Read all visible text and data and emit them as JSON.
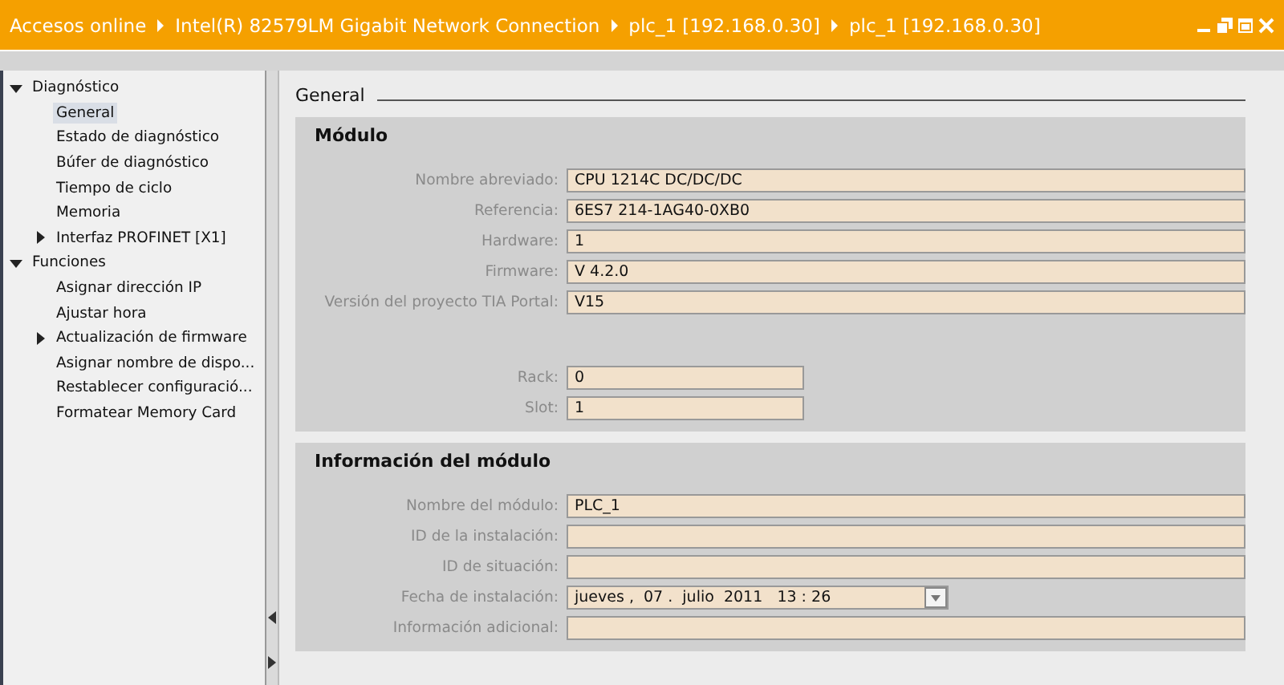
{
  "breadcrumb": [
    "Accesos online",
    "Intel(R) 82579LM Gigabit Network Connection",
    "plc_1 [192.168.0.30]",
    "plc_1 [192.168.0.30]"
  ],
  "tree": [
    {
      "label": "Diagnóstico",
      "expanded": true,
      "selected": false,
      "children": [
        {
          "label": "General",
          "selected": true
        },
        {
          "label": "Estado de diagnóstico",
          "selected": false
        },
        {
          "label": "Búfer de diagnóstico",
          "selected": false
        },
        {
          "label": "Tiempo de ciclo",
          "selected": false
        },
        {
          "label": "Memoria",
          "selected": false
        },
        {
          "label": "Interfaz PROFINET [X1]",
          "expanded": false,
          "selected": false
        }
      ]
    },
    {
      "label": "Funciones",
      "expanded": true,
      "selected": false,
      "children": [
        {
          "label": "Asignar dirección IP",
          "selected": false
        },
        {
          "label": "Ajustar hora",
          "selected": false
        },
        {
          "label": "Actualización de firmware",
          "expanded": false,
          "selected": false
        },
        {
          "label": "Asignar nombre de dispo...",
          "selected": false
        },
        {
          "label": "Restablecer configuració...",
          "selected": false
        },
        {
          "label": "Formatear Memory Card",
          "selected": false
        }
      ]
    }
  ],
  "page_title": "General",
  "sections": [
    {
      "title": "Módulo",
      "fields": [
        {
          "label": "Nombre abreviado:",
          "value": "CPU 1214C DC/DC/DC",
          "kind": "long"
        },
        {
          "label": "Referencia:",
          "value": "6ES7 214-1AG40-0XB0",
          "kind": "long"
        },
        {
          "label": "Hardware:",
          "value": "1",
          "kind": "long"
        },
        {
          "label": "Firmware:",
          "value": "V 4.2.0",
          "kind": "long"
        },
        {
          "label": "Versión del proyecto TIA Portal:",
          "value": "V15",
          "kind": "long"
        },
        {
          "label": "Rack:",
          "value": "0",
          "kind": "short"
        },
        {
          "label": "Slot:",
          "value": "1",
          "kind": "short"
        }
      ]
    },
    {
      "title": "Información del módulo",
      "fields": [
        {
          "label": "Nombre del módulo:",
          "value": "PLC_1",
          "kind": "long"
        },
        {
          "label": "ID de la instalación:",
          "kind": "long"
        },
        {
          "label": "ID de situación:",
          "kind": "long"
        },
        {
          "label": "Fecha de instalación:",
          "value": "jueves ,  07 .  julio  2011   13 : 26",
          "kind": "date"
        },
        {
          "label": "Información adicional:",
          "kind": "long"
        }
      ]
    }
  ]
}
